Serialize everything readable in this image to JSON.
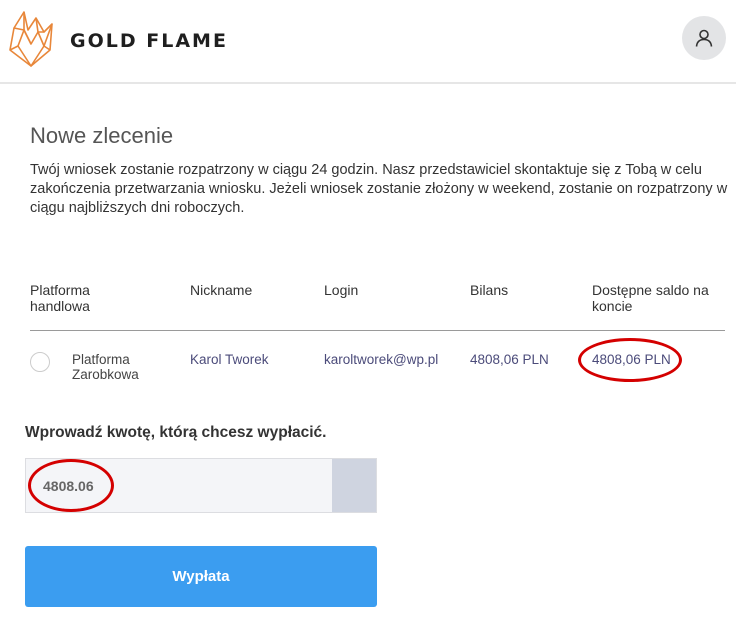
{
  "brand": {
    "name": "GOLD FLAME",
    "accent": "#e8873a"
  },
  "header": {
    "user_icon": "user-icon"
  },
  "page": {
    "title": "Nowe zlecenie",
    "description": "Twój wniosek zostanie rozpatrzony w ciągu 24 godzin. Nasz przedstawiciel skontaktuje się z Tobą w celu zakończenia przetwarzania wniosku. Jeżeli wniosek zostanie złożony w weekend, zostanie on rozpatrzony w ciągu najbliższych dni roboczych."
  },
  "table": {
    "headers": [
      "Platforma handlowa",
      "Nickname",
      "Login",
      "Bilans",
      "Dostępne saldo na koncie"
    ],
    "rows": [
      {
        "platform": "Platforma Zarobkowa",
        "nickname": "Karol Tworek",
        "login": "karoltworek@wp.pl",
        "balance": "4808,06 PLN",
        "available": "4808,06 PLN"
      }
    ]
  },
  "form": {
    "amount_label": "Wprowadź kwotę, którą chcesz wypłacić.",
    "amount_value": "4808.06",
    "submit_label": "Wypłata",
    "submit_color": "#3b9df0"
  },
  "annotations": {
    "circle_color": "#d40000"
  }
}
